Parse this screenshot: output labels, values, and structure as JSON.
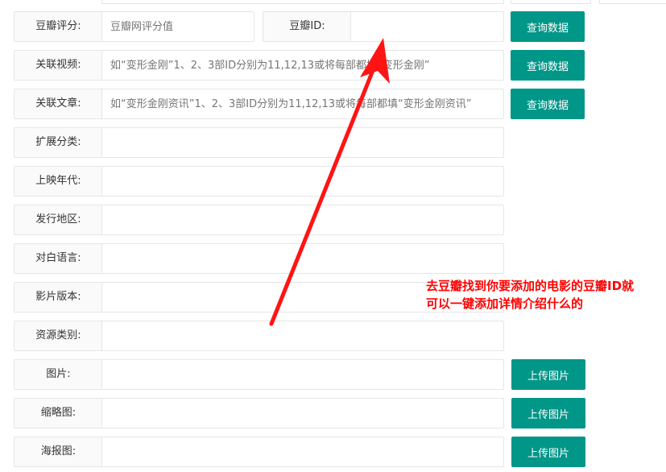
{
  "rows": {
    "douban_score": {
      "label": "豆瓣评分:",
      "placeholder": "豆瓣网评分值",
      "button": "查询数据"
    },
    "douban_id": {
      "label": "豆瓣ID:",
      "value": ""
    },
    "related_video": {
      "label": "关联视频:",
      "placeholder": "如“变形金刚”1、2、3部ID分别为11,12,13或将每部都填“变形金刚”",
      "button": "查询数据"
    },
    "related_article": {
      "label": "关联文章:",
      "placeholder": "如“变形金刚资讯”1、2、3部ID分别为11,12,13或将每部都填“变形金刚资讯”",
      "button": "查询数据"
    },
    "ext_category": {
      "label": "扩展分类:",
      "value": ""
    },
    "release_year": {
      "label": "上映年代:",
      "value": ""
    },
    "region": {
      "label": "发行地区:",
      "value": ""
    },
    "language": {
      "label": "对白语言:",
      "value": ""
    },
    "version": {
      "label": "影片版本:",
      "value": ""
    },
    "resource_type": {
      "label": "资源类别:",
      "value": ""
    },
    "picture": {
      "label": "图片:",
      "button": "上传图片"
    },
    "thumbnail": {
      "label": "缩略图:",
      "button": "上传图片"
    },
    "poster": {
      "label": "海报图:",
      "button": "上传图片"
    }
  },
  "annotation": {
    "line1": "去豆瓣找到你要添加的电影的豆瓣ID就",
    "line2": "可以一键添加详情介绍什么的",
    "color": "#ff0000"
  },
  "accent_color": "#009688"
}
